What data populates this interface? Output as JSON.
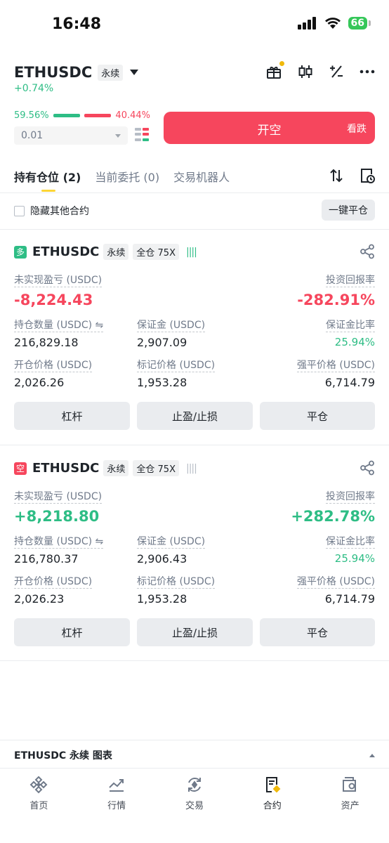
{
  "status": {
    "time": "16:48",
    "battery": "66"
  },
  "header": {
    "symbol": "ETHUSDC",
    "contract_type": "永续",
    "change": "+0.74%",
    "icons": [
      "gift-icon",
      "candlestick-icon",
      "calculator-icon",
      "more-icon"
    ]
  },
  "order": {
    "buy_ratio": "59.56%",
    "sell_ratio": "40.44%",
    "quantity": "0.01",
    "sell_button": "开空",
    "sell_sub": "看跌"
  },
  "tabs": [
    {
      "label": "持有仓位 (2)"
    },
    {
      "label": "当前委托 (0)"
    },
    {
      "label": "交易机器人"
    }
  ],
  "filter": {
    "hide_others": "隐藏其他合约",
    "close_all": "一键平仓"
  },
  "positions": [
    {
      "side": "多",
      "symbol": "ETHUSDC",
      "contract": "永续",
      "margin_mode": "全仓 75X",
      "pnl_label": "未实现盈亏 (USDC)",
      "pnl": "-8,224.43",
      "roi_label": "投资回报率",
      "roi": "-282.91%",
      "size_label": "持仓数量 (USDC) ⇋",
      "size": "216,829.18",
      "margin_label": "保证金 (USDC)",
      "margin": "2,907.09",
      "margin_ratio_label": "保证金比率",
      "margin_ratio": "25.94%",
      "entry_label": "开仓价格 (USDC)",
      "entry": "2,026.26",
      "mark_label": "标记价格 (USDC)",
      "mark": "1,953.28",
      "liq_label": "强平价格 (USDC)",
      "liq": "6,714.79",
      "btn_leverage": "杠杆",
      "btn_tpsl": "止盈/止损",
      "btn_close": "平仓"
    },
    {
      "side": "空",
      "symbol": "ETHUSDC",
      "contract": "永续",
      "margin_mode": "全仓 75X",
      "pnl_label": "未实现盈亏 (USDC)",
      "pnl": "+8,218.80",
      "roi_label": "投资回报率",
      "roi": "+282.78%",
      "size_label": "持仓数量 (USDC) ⇋",
      "size": "216,780.37",
      "margin_label": "保证金 (USDC)",
      "margin": "2,906.43",
      "margin_ratio_label": "保证金比率",
      "margin_ratio": "25.94%",
      "entry_label": "开仓价格 (USDC)",
      "entry": "2,026.23",
      "mark_label": "标记价格 (USDC)",
      "mark": "1,953.28",
      "liq_label": "强平价格 (USDC)",
      "liq": "6,714.79",
      "btn_leverage": "杠杆",
      "btn_tpsl": "止盈/止损",
      "btn_close": "平仓"
    }
  ],
  "chart_bar": {
    "label": "ETHUSDC 永续 图表"
  },
  "nav": [
    {
      "label": "首页",
      "icon": "home-icon"
    },
    {
      "label": "行情",
      "icon": "markets-icon"
    },
    {
      "label": "交易",
      "icon": "trade-icon"
    },
    {
      "label": "合约",
      "icon": "futures-icon"
    },
    {
      "label": "资产",
      "icon": "wallet-icon"
    }
  ],
  "colors": {
    "green": "#2ebd85",
    "red": "#f6465d",
    "accent": "#fcd535"
  }
}
